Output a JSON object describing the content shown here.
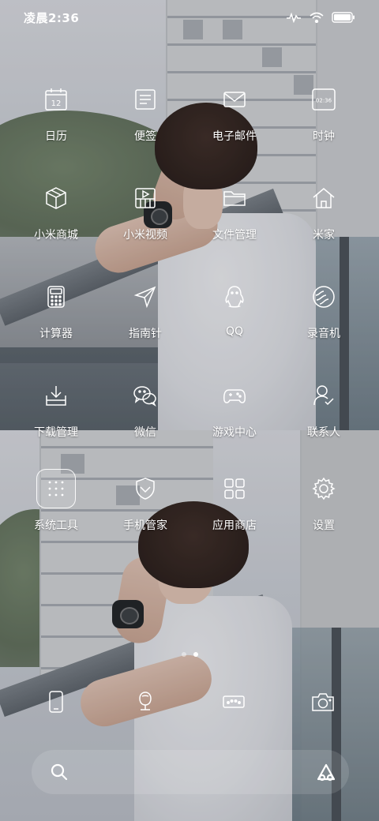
{
  "status_bar": {
    "time": "凌晨2:36",
    "icons": [
      "signal-wave-icon",
      "wifi-icon",
      "battery-icon"
    ]
  },
  "apps": [
    {
      "label": "日历",
      "icon": "calendar-icon",
      "number": "12"
    },
    {
      "label": "便签",
      "icon": "notes-icon"
    },
    {
      "label": "电子邮件",
      "icon": "mail-icon"
    },
    {
      "label": "时钟",
      "icon": "clock-icon",
      "time": "02:36"
    },
    {
      "label": "小米商城",
      "icon": "store-box-icon"
    },
    {
      "label": "小米视频",
      "icon": "video-icon"
    },
    {
      "label": "文件管理",
      "icon": "folder-icon"
    },
    {
      "label": "米家",
      "icon": "home-icon"
    },
    {
      "label": "计算器",
      "icon": "calculator-icon"
    },
    {
      "label": "指南针",
      "icon": "compass-icon"
    },
    {
      "label": "QQ",
      "icon": "qq-penguin-icon"
    },
    {
      "label": "录音机",
      "icon": "recorder-icon"
    },
    {
      "label": "下载管理",
      "icon": "download-icon"
    },
    {
      "label": "微信",
      "icon": "wechat-icon"
    },
    {
      "label": "游戏中心",
      "icon": "gamepad-icon"
    },
    {
      "label": "联系人",
      "icon": "contacts-icon"
    },
    {
      "label": "系统工具",
      "icon": "folder-group-icon"
    },
    {
      "label": "手机管家",
      "icon": "shield-icon"
    },
    {
      "label": "应用商店",
      "icon": "app-store-icon"
    },
    {
      "label": "设置",
      "icon": "settings-gear-icon"
    }
  ],
  "pages": {
    "count": 2,
    "active_index": 1
  },
  "dock": [
    {
      "icon": "phone-icon"
    },
    {
      "icon": "message-icon"
    },
    {
      "icon": "browser-icon"
    },
    {
      "icon": "camera-icon"
    }
  ],
  "search_bar": {
    "left_icon": "search-icon",
    "right_icon": "assistant-icon"
  },
  "colors": {
    "text": "#ffffff",
    "icon_stroke": "#ffffff"
  }
}
